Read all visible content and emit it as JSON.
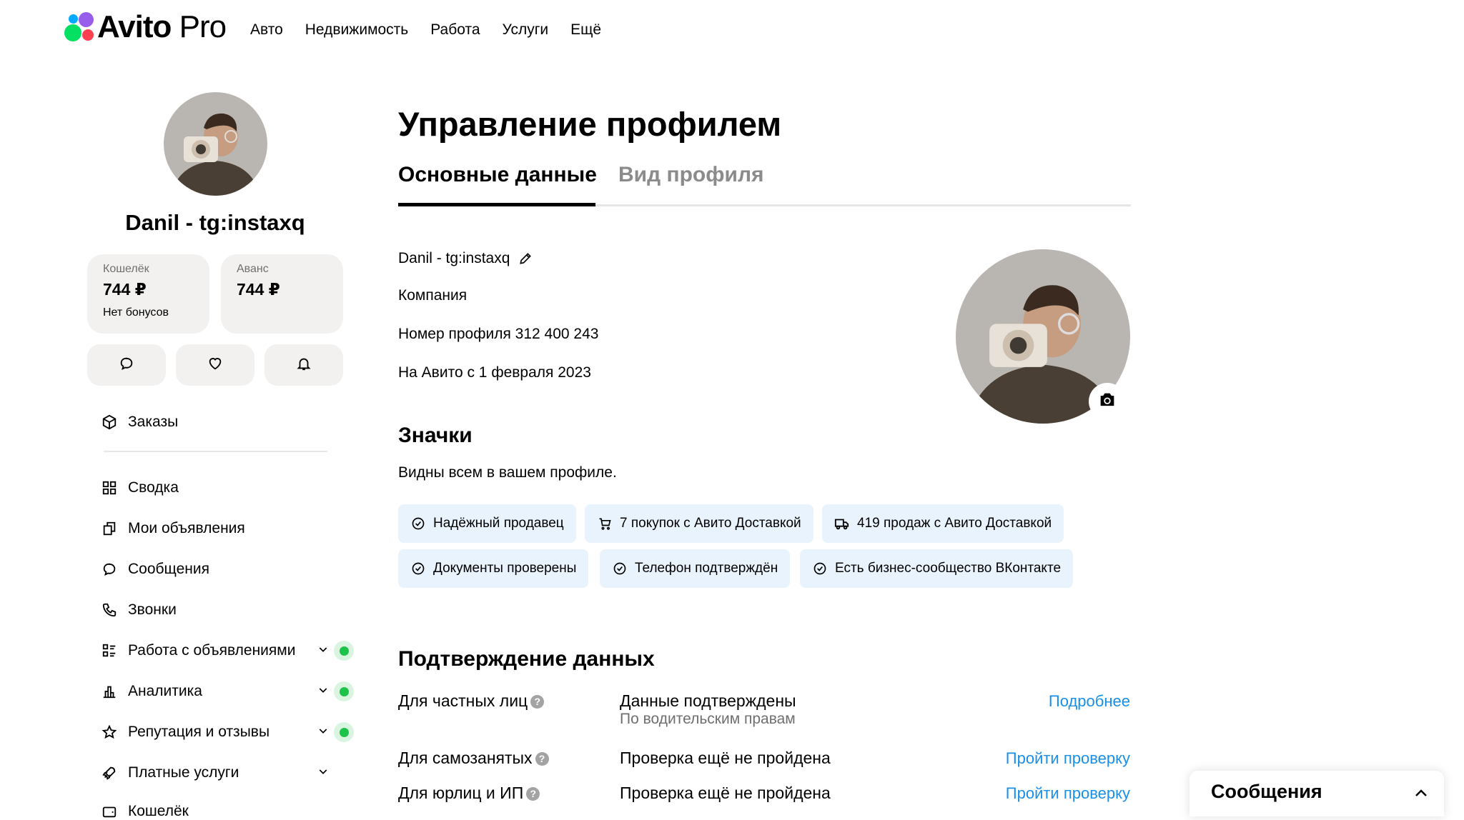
{
  "header": {
    "logo_main": "Avito",
    "logo_pro": "Pro",
    "nav": [
      "Авто",
      "Недвижимость",
      "Работа",
      "Услуги",
      "Ещё"
    ]
  },
  "sidebar": {
    "user_name": "Danil - tg:instaxq",
    "wallet": {
      "label": "Кошелёк",
      "value": "744 ₽",
      "sub": "Нет бонусов"
    },
    "advance": {
      "label": "Аванс",
      "value": "744 ₽"
    },
    "quick_icons": [
      "chat-icon",
      "heart-icon",
      "bell-icon"
    ],
    "orders": "Заказы",
    "items": [
      {
        "label": "Сводка",
        "icon": "grid-icon"
      },
      {
        "label": "Мои объявления",
        "icon": "copy-icon"
      },
      {
        "label": "Сообщения",
        "icon": "chat-icon"
      },
      {
        "label": "Звонки",
        "icon": "phone-icon"
      },
      {
        "label": "Работа с объявлениями",
        "icon": "list-icon",
        "expandable": true,
        "status_dot": true
      },
      {
        "label": "Аналитика",
        "icon": "bar-chart-icon",
        "expandable": true,
        "status_dot": true
      },
      {
        "label": "Репутация и отзывы",
        "icon": "star-icon",
        "expandable": true,
        "status_dot": true
      },
      {
        "label": "Платные услуги",
        "icon": "rocket-icon",
        "expandable": true,
        "status_dot": false
      },
      {
        "label": "Кошелёк",
        "icon": "wallet-icon"
      }
    ]
  },
  "main": {
    "title": "Управление профилем",
    "tabs": [
      {
        "label": "Основные данные",
        "active": true
      },
      {
        "label": "Вид профиля",
        "active": false
      }
    ],
    "profile": {
      "name": "Danil - tg:instaxq",
      "type": "Компания",
      "number": "Номер профиля 312 400 243",
      "since": "На Авито с 1 февраля 2023"
    },
    "badges_title": "Значки",
    "badges_desc": "Видны всем в вашем профиле.",
    "badges": [
      {
        "label": "Надёжный продавец",
        "icon": "check-circle-icon"
      },
      {
        "label": "7 покупок с Авито Доставкой",
        "icon": "cart-icon"
      },
      {
        "label": "419 продаж с Авито Доставкой",
        "icon": "truck-icon"
      },
      {
        "label": "Документы проверены",
        "icon": "check-circle-icon"
      },
      {
        "label": "Телефон подтверждён",
        "icon": "check-circle-icon"
      },
      {
        "label": "Есть бизнес-сообщество ВКонтакте",
        "icon": "check-circle-icon"
      }
    ],
    "verification_title": "Подтверждение данных",
    "verification": [
      {
        "label": "Для частных лиц",
        "status": "Данные подтверждены",
        "detail": "По водительским правам",
        "link": "Подробнее"
      },
      {
        "label": "Для самозанятых",
        "status": "Проверка ещё не пройдена",
        "link": "Пройти проверку"
      },
      {
        "label": "Для юрлиц и ИП",
        "status": "Проверка ещё не пройдена",
        "link": "Пройти проверку"
      }
    ],
    "question_mark": "?"
  },
  "messages_widget": {
    "title": "Сообщения"
  },
  "colors": {
    "link": "#1a8fe8",
    "badge_bg": "#e8f3fd",
    "green": "#1cc34b",
    "card_bg": "#f2f1f0"
  }
}
